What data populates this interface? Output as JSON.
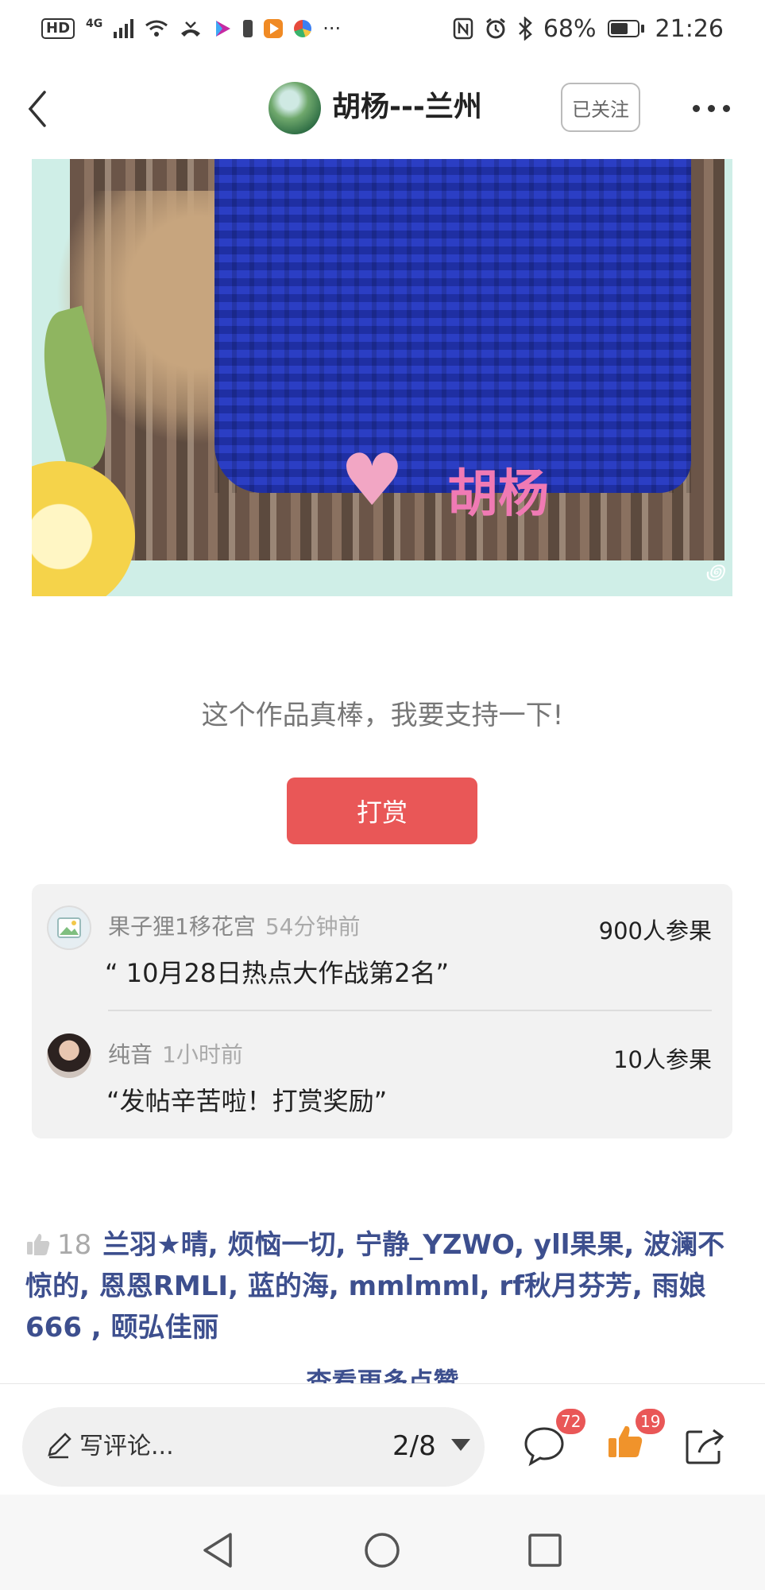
{
  "status_bar": {
    "hd_label": "HD",
    "network": "4G",
    "battery_percent": "68%",
    "time": "21:26"
  },
  "header": {
    "title": "胡杨---兰州",
    "follow_label": "已关注"
  },
  "photo": {
    "watermark": "胡杨"
  },
  "support": {
    "text": "这个作品真棒，我要支持一下!",
    "button_label": "打赏"
  },
  "rewards": [
    {
      "name": "果子狸1移花宫",
      "time": "54分钟前",
      "count": "900人参果",
      "quote": "“ 10月28日热点大作战第2名”"
    },
    {
      "name": "纯音",
      "time": "1小时前",
      "count": "10人参果",
      "quote": "“发帖辛苦啦！打赏奖励”"
    }
  ],
  "likes": {
    "count": "18",
    "names": "兰羽★晴, 烦恼一切, 宁静_YZWO, yll果果, 波澜不惊的, 恩恩RMLI, 蓝的海, mmlmml, rf秋月芬芳, 雨娘666 , 颐弘佳丽",
    "more_label": "查看更多点赞"
  },
  "bottom_bar": {
    "comment_placeholder": "写评论...",
    "page_indicator": "2/8",
    "comment_badge": "72",
    "like_badge": "19"
  },
  "colors": {
    "accent_red": "#e95757",
    "link_blue": "#3d4f8e",
    "like_orange": "#f0932b"
  }
}
